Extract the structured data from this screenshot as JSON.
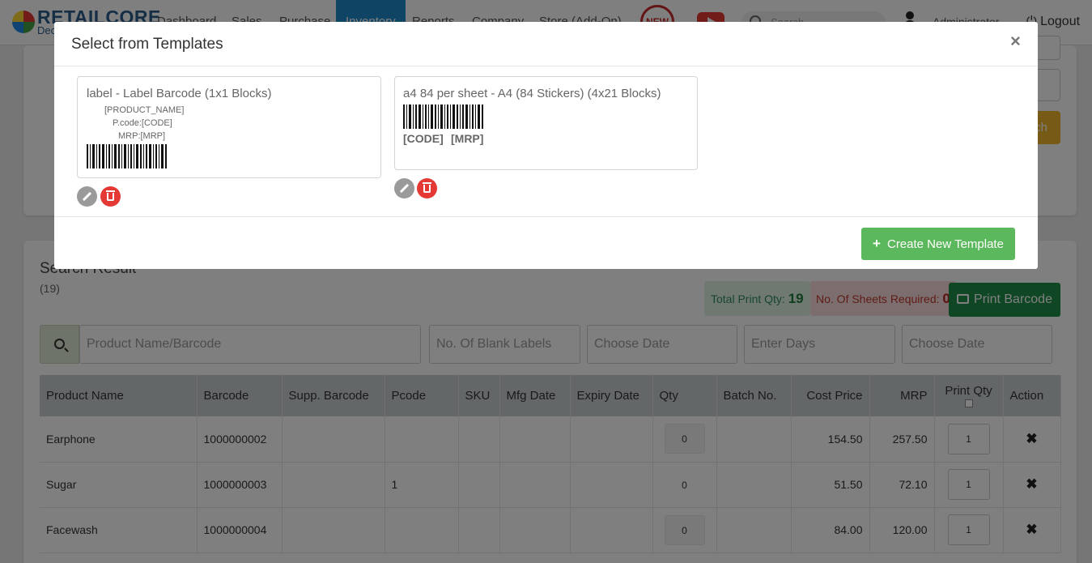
{
  "navbar": {
    "logo": "RETAILCORE",
    "logo_sub": "Dec",
    "items": [
      "Dashboard",
      "Sales",
      "Purchase",
      "Inventory",
      "Reports",
      "Company",
      "Store (Add-On)"
    ],
    "promo_label": "NEW",
    "search_placeholder": "Search",
    "user": "Administrator",
    "logout": "Logout"
  },
  "filter_card": {
    "search_button": "Search"
  },
  "results": {
    "title": "Search Result",
    "count": "(19)",
    "total_print_qty_label": "Total Print Qty:",
    "total_print_qty": "19",
    "sheets_label": "No. Of Sheets Required:",
    "sheets_value": "0",
    "print_button": "Print Barcode"
  },
  "filters": {
    "product": "Product Name/Barcode",
    "blank_labels": "No. Of Blank Labels",
    "mfg_date": "Choose Date",
    "days": "Enter Days",
    "expiry_date": "Choose Date"
  },
  "table": {
    "headers": [
      "Product Name",
      "Barcode",
      "Supp. Barcode",
      "Pcode",
      "SKU",
      "Mfg Date",
      "Expiry Date",
      "Qty",
      "Batch No.",
      "Cost Price",
      "MRP",
      "Print Qty",
      "Action"
    ],
    "rows": [
      {
        "name": "Earphone",
        "barcode": "1000000002",
        "supp_barcode": "",
        "pcode": "",
        "sku": "",
        "mfg": "",
        "expiry": "",
        "qty": "0",
        "batch": "",
        "cost": "154.50",
        "mrp": "257.50",
        "print_qty": "1"
      },
      {
        "name": "Sugar",
        "barcode": "1000000003",
        "supp_barcode": "",
        "pcode": "1",
        "sku": "",
        "mfg": "",
        "expiry": "",
        "qty": "0",
        "batch": "",
        "cost": "51.50",
        "mrp": "72.10",
        "print_qty": "1"
      },
      {
        "name": "Facewash",
        "barcode": "1000000004",
        "supp_barcode": "",
        "pcode": "",
        "sku": "",
        "mfg": "",
        "expiry": "",
        "qty": "0",
        "batch": "",
        "cost": "84.00",
        "mrp": "120.00",
        "print_qty": "1"
      }
    ]
  },
  "modal": {
    "title": "Select from Templates",
    "close": "×",
    "templates": [
      {
        "name": "label - Label Barcode (1x1 Blocks)",
        "lines": [
          "[PRODUCT_NAME]",
          "P.code:[CODE]",
          "MRP:[MRP]"
        ]
      },
      {
        "name": "a4 84 per sheet - A4 (84 Stickers) (4x21 Blocks)",
        "code": "[CODE]",
        "mrp": "[MRP]"
      }
    ],
    "create_button": "Create New Template",
    "create_icon": "+"
  },
  "colors": {
    "primary": "#1e88c8",
    "success": "#5cb85c",
    "print": "#1f8f4a",
    "danger": "#e53935",
    "warning": "#f1b52f"
  }
}
